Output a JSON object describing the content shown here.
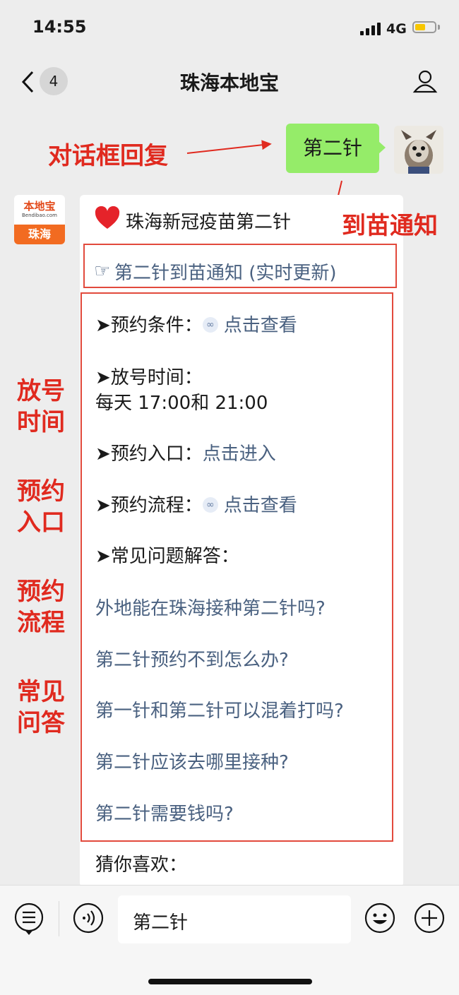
{
  "status_bar": {
    "time": "14:55",
    "network": "4G"
  },
  "nav": {
    "back_count": "4",
    "title": "珠海本地宝"
  },
  "chat": {
    "user_message": "第二针",
    "reply_card": {
      "title": "珠海新冠疫苗第二针",
      "notice_icon": "☞",
      "notice_link": "第二针到苗通知 (实时更新)",
      "items": [
        {
          "label": "➤预约条件：",
          "link": "点击查看"
        },
        {
          "label": "➤放号时间：",
          "value": "每天 17:00和 21:00"
        },
        {
          "label": "➤预约入口：",
          "link": "点击进入"
        },
        {
          "label": "➤预约流程：",
          "link": "点击查看"
        },
        {
          "label": "➤常见问题解答："
        }
      ],
      "faqs": [
        "外地能在珠海接种第二针吗?",
        "第二针预约不到怎么办?",
        "第一针和第二针可以混着打吗?",
        "第二针应该去哪里接种?",
        "第二针需要钱吗?"
      ],
      "more": "猜你喜欢："
    },
    "account_logo": {
      "name": "本地宝",
      "url": "Bendibao.com",
      "city": "珠海"
    }
  },
  "annotations": {
    "reply": "对话框回复",
    "notice": "到苗通知",
    "time": "放号时间",
    "entry": "预约入口",
    "process": "预约流程",
    "faq": "常见问答"
  },
  "input_bar": {
    "text": "第二针"
  },
  "colors": {
    "link": "#4a6180",
    "annotation": "#e02a1f",
    "bubble": "#95ec69",
    "highlight_box": "#e24a3c"
  }
}
